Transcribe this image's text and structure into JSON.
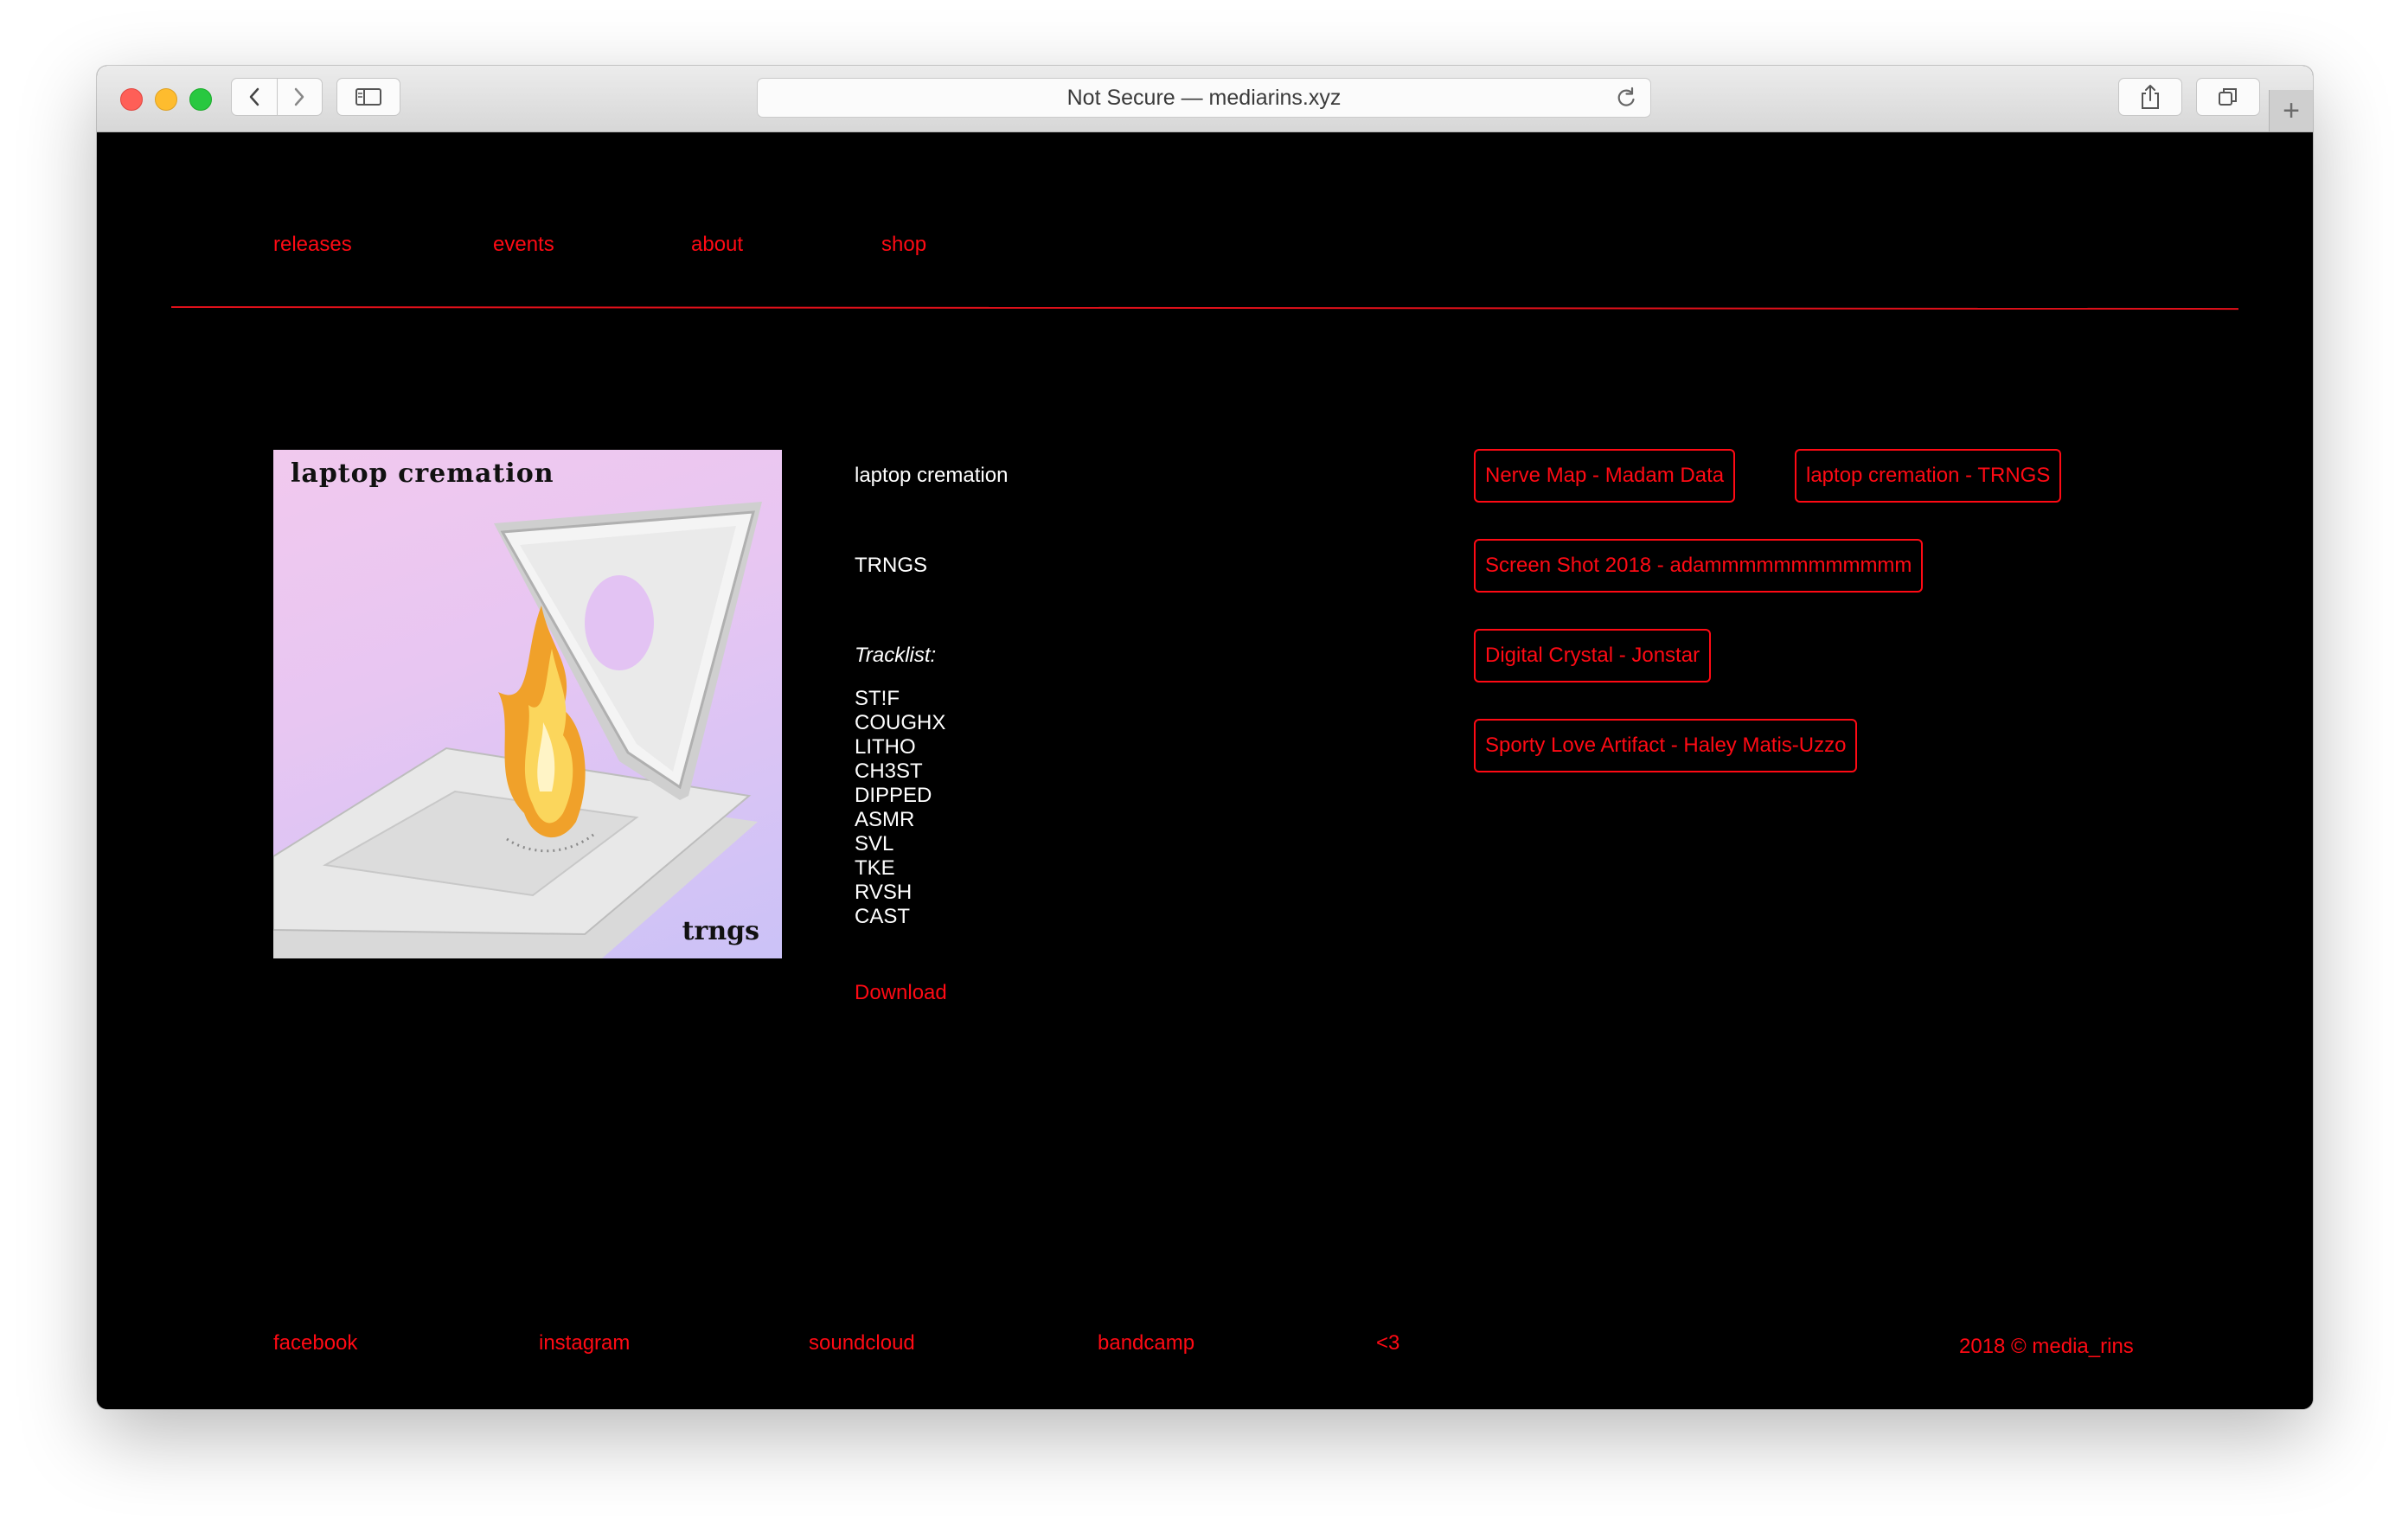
{
  "browser": {
    "address": "Not Secure — mediarins.xyz",
    "new_tab_symbol": "+",
    "icons": [
      "back-icon",
      "forward-icon",
      "sidebar-icon",
      "reload-icon",
      "share-icon",
      "tabs-icon"
    ]
  },
  "nav": {
    "items": [
      {
        "label": "releases"
      },
      {
        "label": "events"
      },
      {
        "label": "about"
      },
      {
        "label": "shop"
      }
    ]
  },
  "release": {
    "cover_title": "laptop cremation",
    "cover_artist": "trngs",
    "title": "laptop cremation",
    "artist": "TRNGS",
    "tracklist_label": "Tracklist:",
    "tracks": [
      "ST!F",
      "COUGHX",
      "LITHO",
      "CH3ST",
      "DIPPED",
      "ASMR",
      "SVL",
      "TKE",
      "RVSH",
      "CAST"
    ],
    "download_label": "Download"
  },
  "other_releases": [
    {
      "label": "Nerve Map - Madam Data"
    },
    {
      "label": "laptop cremation - TRNGS"
    },
    {
      "label": "Screen Shot 2018 - adammmmmmmmmmmm"
    },
    {
      "label": "Digital Crystal - Jonstar"
    },
    {
      "label": "Sporty Love Artifact - Haley Matis-Uzzo"
    }
  ],
  "footer": {
    "links": [
      {
        "label": "facebook"
      },
      {
        "label": "instagram"
      },
      {
        "label": "soundcloud"
      },
      {
        "label": "bandcamp"
      },
      {
        "label": "<3"
      }
    ],
    "copyright": "2018 © media_rins"
  },
  "colors": {
    "accent": "#ff0a14",
    "background": "#000000",
    "text": "#ffffff"
  }
}
